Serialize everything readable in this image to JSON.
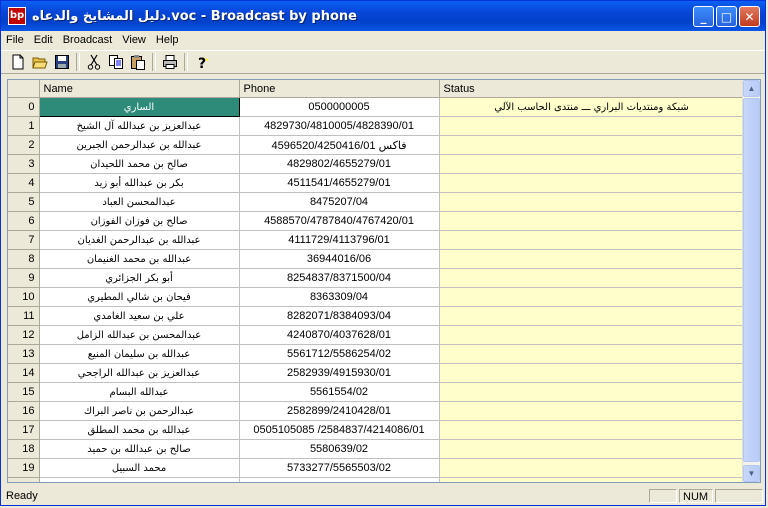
{
  "window": {
    "title": "دليل المشايخ والدعاه.voc - Broadcast by phone",
    "icon_text": "bp"
  },
  "menu": [
    "File",
    "Edit",
    "Broadcast",
    "View",
    "Help"
  ],
  "toolbar": [
    "new-icon",
    "open-icon",
    "save-icon",
    "cut-icon",
    "copy-icon",
    "paste-icon",
    "print-icon",
    "help-icon"
  ],
  "columns": {
    "name": "Name",
    "phone": "Phone",
    "status": "Status"
  },
  "rows": [
    {
      "num": "0",
      "name": "الساري",
      "phone": "0500000005",
      "status": "شبكة ومنتديات البراري ـــ منتدى الحاسب الآلي"
    },
    {
      "num": "1",
      "name": "عبدالعزيز بن عبدالله آل الشيخ",
      "phone": "4829730/4810005/4828390/01",
      "status": ""
    },
    {
      "num": "2",
      "name": "عبدالله بن عبدالرحمن الجبرين",
      "phone": "فاكس 4596520/4250416/01",
      "status": ""
    },
    {
      "num": "3",
      "name": "صالح بن محمد اللحيدان",
      "phone": "4829802/4655279/01",
      "status": ""
    },
    {
      "num": "4",
      "name": "بكر بن عبدالله أبو زيد",
      "phone": "4511541/4655279/01",
      "status": ""
    },
    {
      "num": "5",
      "name": "عبدالمحسن العباد",
      "phone": "8475207/04",
      "status": ""
    },
    {
      "num": "6",
      "name": "صالح بن فوزان الفوزان",
      "phone": "4588570/4787840/4767420/01",
      "status": ""
    },
    {
      "num": "7",
      "name": "عبدالله بن عبدالرحمن الغديان",
      "phone": "4111729/4113796/01",
      "status": ""
    },
    {
      "num": "8",
      "name": "عبدالله بن محمد الغنيمان",
      "phone": "36944016/06",
      "status": ""
    },
    {
      "num": "9",
      "name": "أبو بكر الجزائري",
      "phone": "8254837/8371500/04",
      "status": ""
    },
    {
      "num": "10",
      "name": "فيحان بن شالي المطيري",
      "phone": "8363309/04",
      "status": ""
    },
    {
      "num": "11",
      "name": "علي بن سعيد الغامدي",
      "phone": "8282071/8384093/04",
      "status": ""
    },
    {
      "num": "12",
      "name": "عبدالمحسن بن عبدالله الزامل",
      "phone": "4240870/4037628/01",
      "status": ""
    },
    {
      "num": "13",
      "name": "عبدالله بن سليمان المنيع",
      "phone": "5561712/5586254/02",
      "status": ""
    },
    {
      "num": "14",
      "name": "عبدالعزيز بن عبدالله الراجحي",
      "phone": "2582939/4915930/01",
      "status": ""
    },
    {
      "num": "15",
      "name": "عبدالله البسام",
      "phone": "5561554/02",
      "status": ""
    },
    {
      "num": "16",
      "name": "عبدالرحمن بن ناصر البراك",
      "phone": "2582899/2410428/01",
      "status": ""
    },
    {
      "num": "17",
      "name": "عبدالله بن محمد المطلق",
      "phone": "0505105085 /2584837/4214086/01",
      "status": ""
    },
    {
      "num": "18",
      "name": "صالح بن عبدالله بن حميد",
      "phone": "5580639/02",
      "status": ""
    },
    {
      "num": "19",
      "name": "محمد السبيل",
      "phone": "5733277/5565503/02",
      "status": ""
    },
    {
      "num": "20",
      "name": "",
      "phone": "",
      "status": ""
    }
  ],
  "statusbar": {
    "text": "Ready",
    "num": "NUM"
  },
  "colors": {
    "selected_cell": "#2e8b7a",
    "status_cell": "#ffffcc"
  }
}
